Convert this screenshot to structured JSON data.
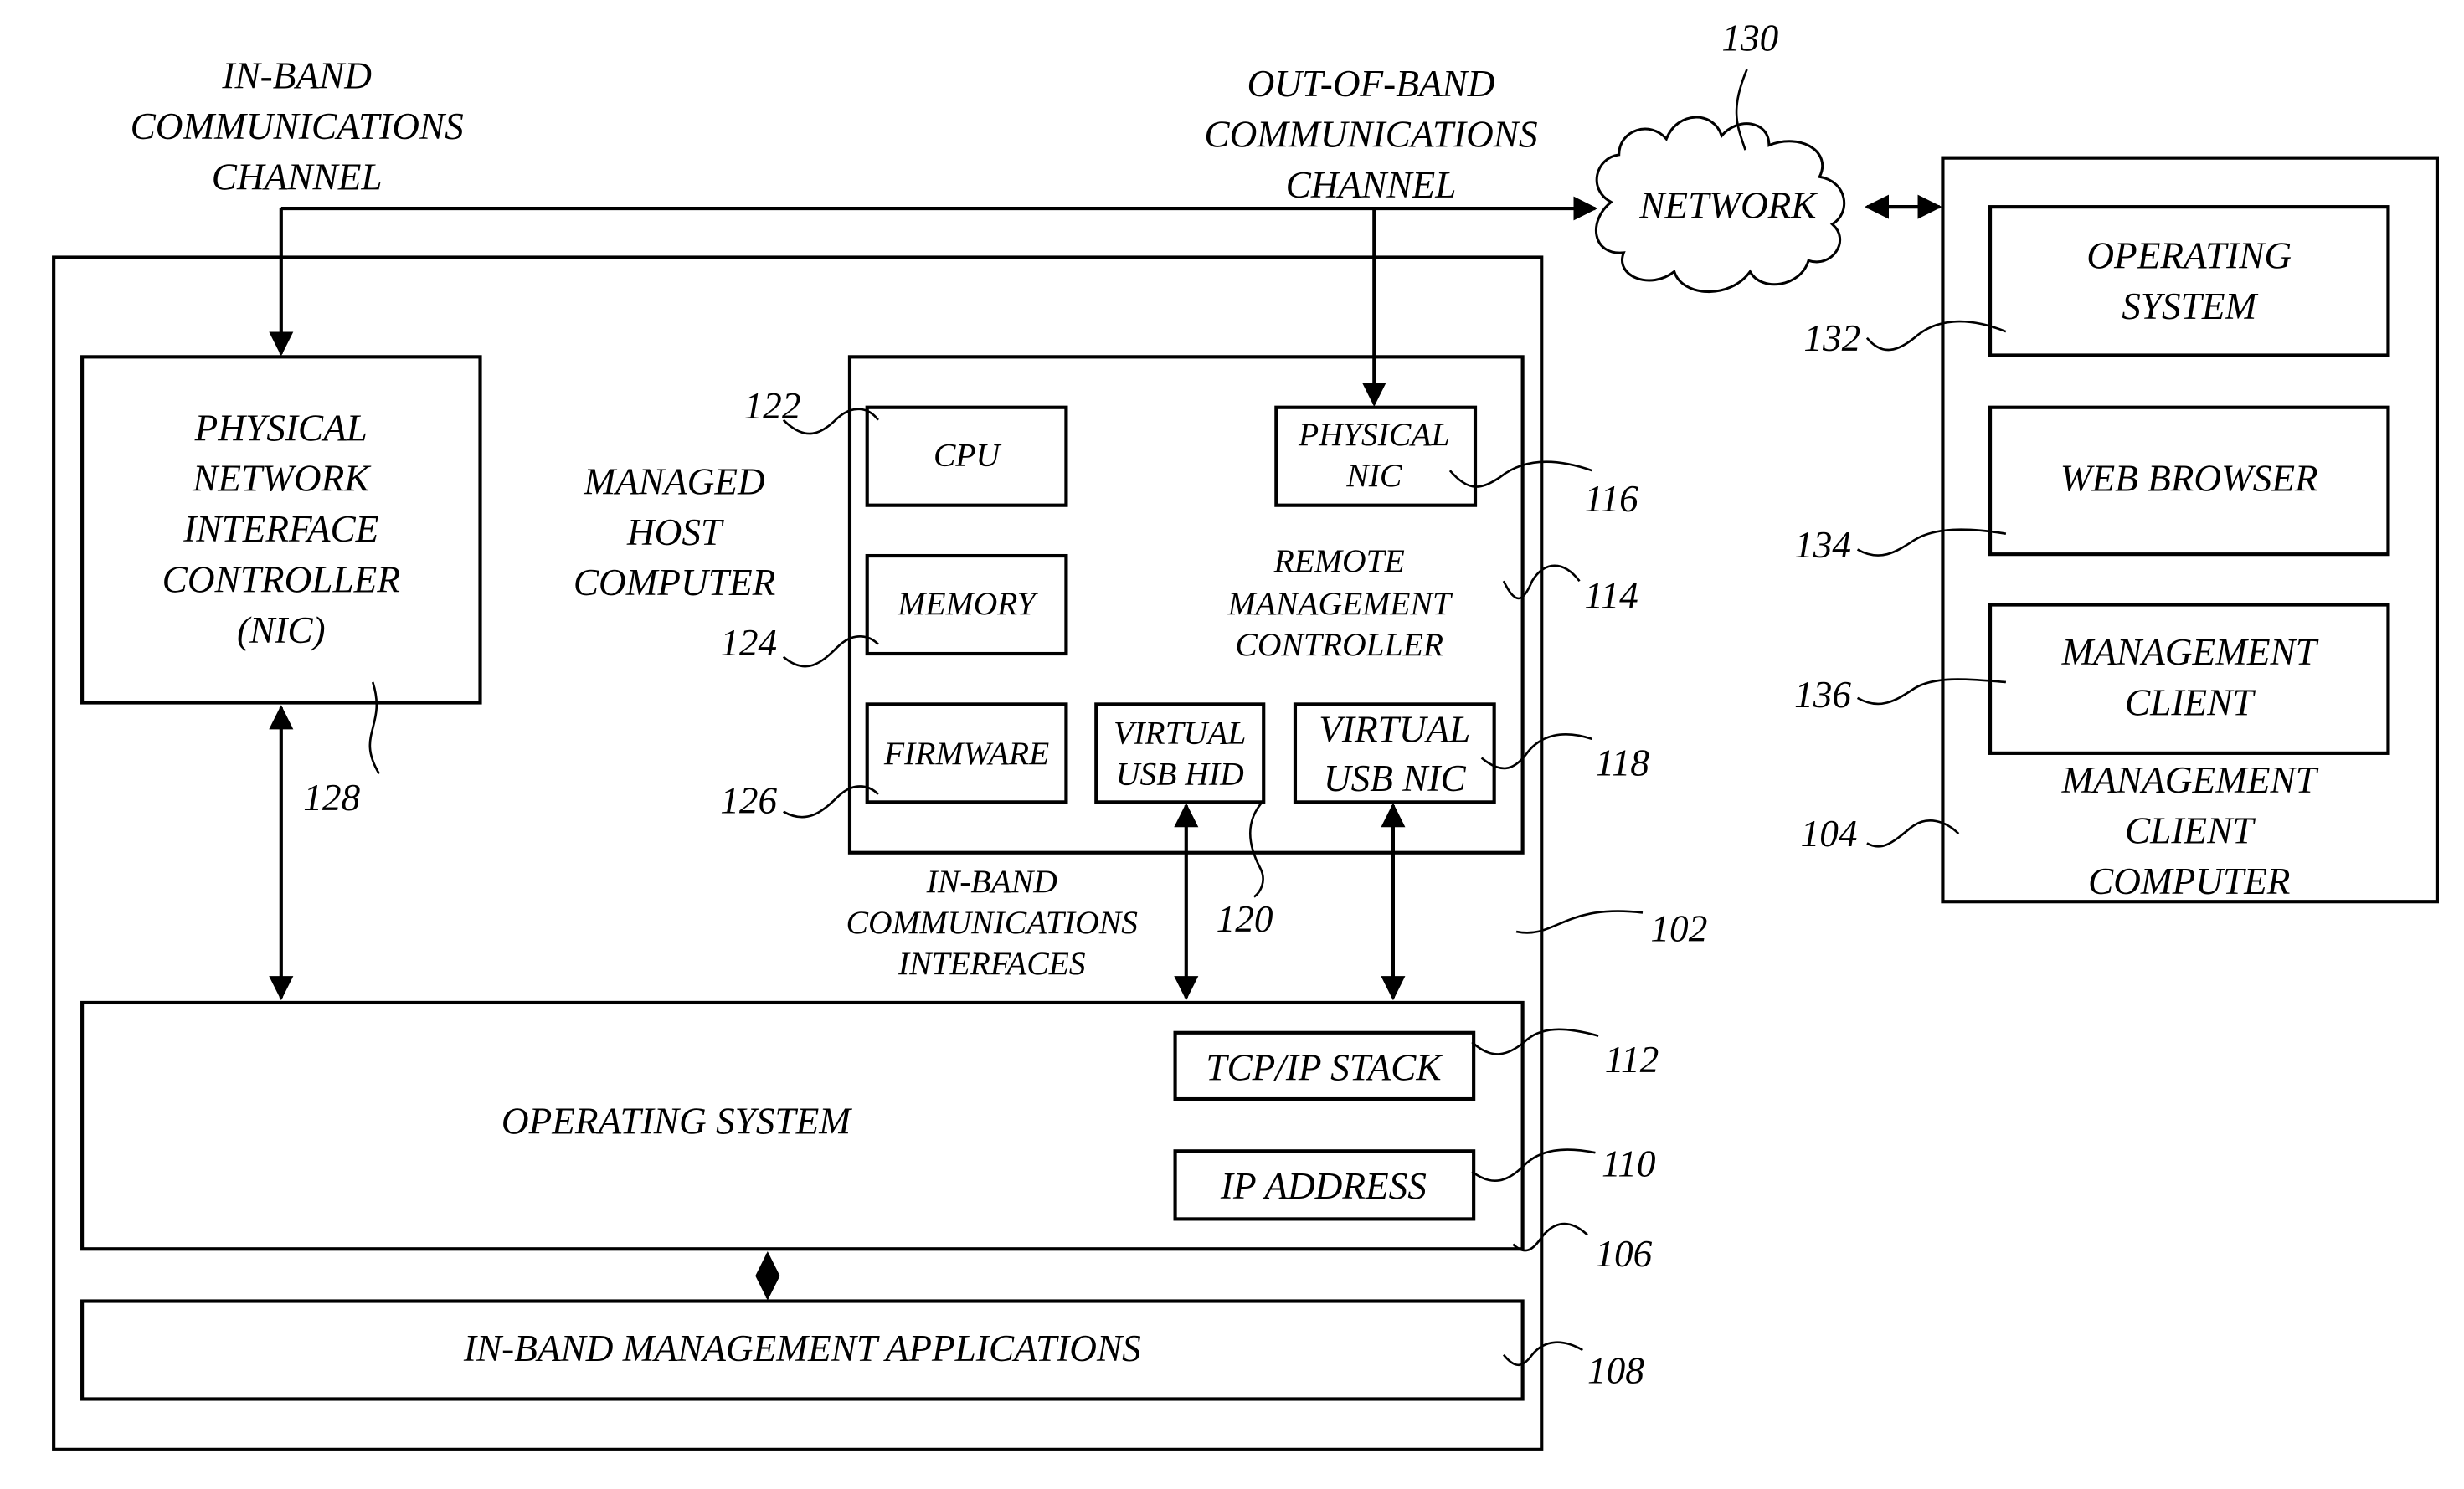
{
  "diagram": {
    "in_band_channel_label": [
      "IN-BAND",
      "COMMUNICATIONS",
      "CHANNEL"
    ],
    "out_of_band_channel_label": [
      "OUT-OF-BAND",
      "COMMUNICATIONS",
      "CHANNEL"
    ],
    "network": {
      "label": "NETWORK",
      "ref": "130"
    },
    "managed_host": {
      "label": [
        "MANAGED",
        "HOST",
        "COMPUTER"
      ],
      "ref": "102",
      "physical_nic": {
        "label": [
          "PHYSICAL",
          "NETWORK",
          "INTERFACE",
          "CONTROLLER",
          "(NIC)"
        ],
        "ref": "128"
      },
      "remote_management_controller": {
        "label": [
          "REMOTE",
          "MANAGEMENT",
          "CONTROLLER"
        ],
        "ref": "114",
        "cpu": {
          "label": "CPU",
          "ref": "122"
        },
        "memory": {
          "label": "MEMORY",
          "ref": "124"
        },
        "firmware": {
          "label": "FIRMWARE",
          "ref": "126"
        },
        "physical_nic": {
          "label": [
            "PHYSICAL",
            "NIC"
          ],
          "ref": "116"
        },
        "virtual_usb_hid": {
          "label": [
            "VIRTUAL",
            "USB HID"
          ],
          "ref": "120"
        },
        "virtual_usb_nic": {
          "label": [
            "VIRTUAL",
            "USB NIC"
          ],
          "ref": "118"
        }
      },
      "in_band_interfaces_label": [
        "IN-BAND",
        "COMMUNICATIONS",
        "INTERFACES"
      ],
      "operating_system": {
        "label": "OPERATING SYSTEM",
        "ref": "106",
        "tcp_ip_stack": {
          "label": "TCP/IP STACK",
          "ref": "112"
        },
        "ip_address": {
          "label": "IP ADDRESS",
          "ref": "110"
        }
      },
      "in_band_apps": {
        "label": "IN-BAND MANAGEMENT APPLICATIONS",
        "ref": "108"
      }
    },
    "management_client_computer": {
      "label": [
        "MANAGEMENT",
        "CLIENT",
        "COMPUTER"
      ],
      "ref": "104",
      "operating_system": {
        "label": [
          "OPERATING",
          "SYSTEM"
        ],
        "ref": "132"
      },
      "web_browser": {
        "label": "WEB BROWSER",
        "ref": "134"
      },
      "management_client": {
        "label": [
          "MANAGEMENT",
          "CLIENT"
        ],
        "ref": "136"
      }
    }
  }
}
